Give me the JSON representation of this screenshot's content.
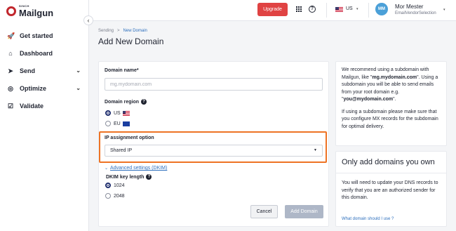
{
  "brand": {
    "small": "SINCH",
    "name": "Mailgun"
  },
  "sidebar": {
    "collapse_glyph": "‹",
    "items": [
      {
        "label": "Get started",
        "icon": "rocket-icon",
        "glyph": "🚀",
        "has_chevron": false
      },
      {
        "label": "Dashboard",
        "icon": "home-icon",
        "glyph": "⌂",
        "has_chevron": false
      },
      {
        "label": "Send",
        "icon": "send-icon",
        "glyph": "➤",
        "has_chevron": true
      },
      {
        "label": "Optimize",
        "icon": "optimize-icon",
        "glyph": "◎",
        "has_chevron": true
      },
      {
        "label": "Validate",
        "icon": "validate-icon",
        "glyph": "☑",
        "has_chevron": false
      }
    ],
    "chevron_glyph": "⌄"
  },
  "topbar": {
    "upgrade_label": "Upgrade",
    "help_glyph": "?",
    "region": "US",
    "caret": "▾",
    "user": {
      "initials": "MM",
      "name": "Mor Mester",
      "account": "EmailVendorSelection"
    }
  },
  "breadcrumb": {
    "parent": "Sending",
    "separator": ">",
    "current": "New Domain"
  },
  "page_title": "Add New Domain",
  "form": {
    "domain_label": "Domain name*",
    "domain_placeholder": "mg.mydomain.com",
    "domain_value": "",
    "region_label": "Domain region",
    "info_glyph": "?",
    "region_options": [
      {
        "label": "US",
        "checked": true
      },
      {
        "label": "EU",
        "checked": false
      }
    ],
    "ip_label": "IP assignment option",
    "ip_selected": "Shared IP",
    "select_caret": "▼",
    "advanced_chevron": "⌄",
    "advanced_label": "Advanced settings (DKIM)",
    "dkim_label": "DKIM key length",
    "dkim_options": [
      {
        "label": "1024",
        "checked": true
      },
      {
        "label": "2048",
        "checked": false
      }
    ],
    "cancel_label": "Cancel",
    "add_label": "Add Domain"
  },
  "info_panel": {
    "p1_part1": "We recommend using a subdomain with Mailgun, like \"",
    "p1_bold1": "mg.mydomain.com",
    "p1_part2": "\". Using a subdomain you will be able to send emails from your root domain e.g. \"",
    "p1_bold2": "you@mydomain.com",
    "p1_part3": "\".",
    "p2": "If using a subdomain please make sure that you configure MX records for the subdomain for optimal delivery."
  },
  "own_panel": {
    "title": "Only add domains you own",
    "text": "You will need to update your DNS records to verify that you are an authorized sender for this domain.",
    "link": "What domain should I use ?"
  },
  "colors": {
    "accent_red": "#e04343",
    "link_blue": "#2d6fbd",
    "highlight_orange": "#ee7324",
    "avatar_blue": "#4ba0d8"
  }
}
